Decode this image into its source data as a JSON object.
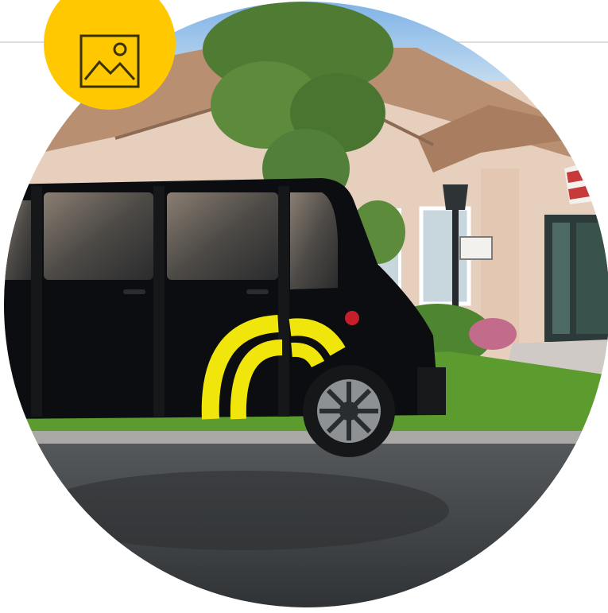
{
  "colors": {
    "badge": "#ffc800",
    "vehicle_body": "#0b0d10",
    "vehicle_stripe": "#f1e60c",
    "lawn": "#5c9c2e",
    "road": "#3d4043",
    "roof": "#b98f72",
    "wall": "#e6cfbd",
    "sky": "#9ec6ea"
  },
  "icons": {
    "badge_icon": "image-icon"
  }
}
